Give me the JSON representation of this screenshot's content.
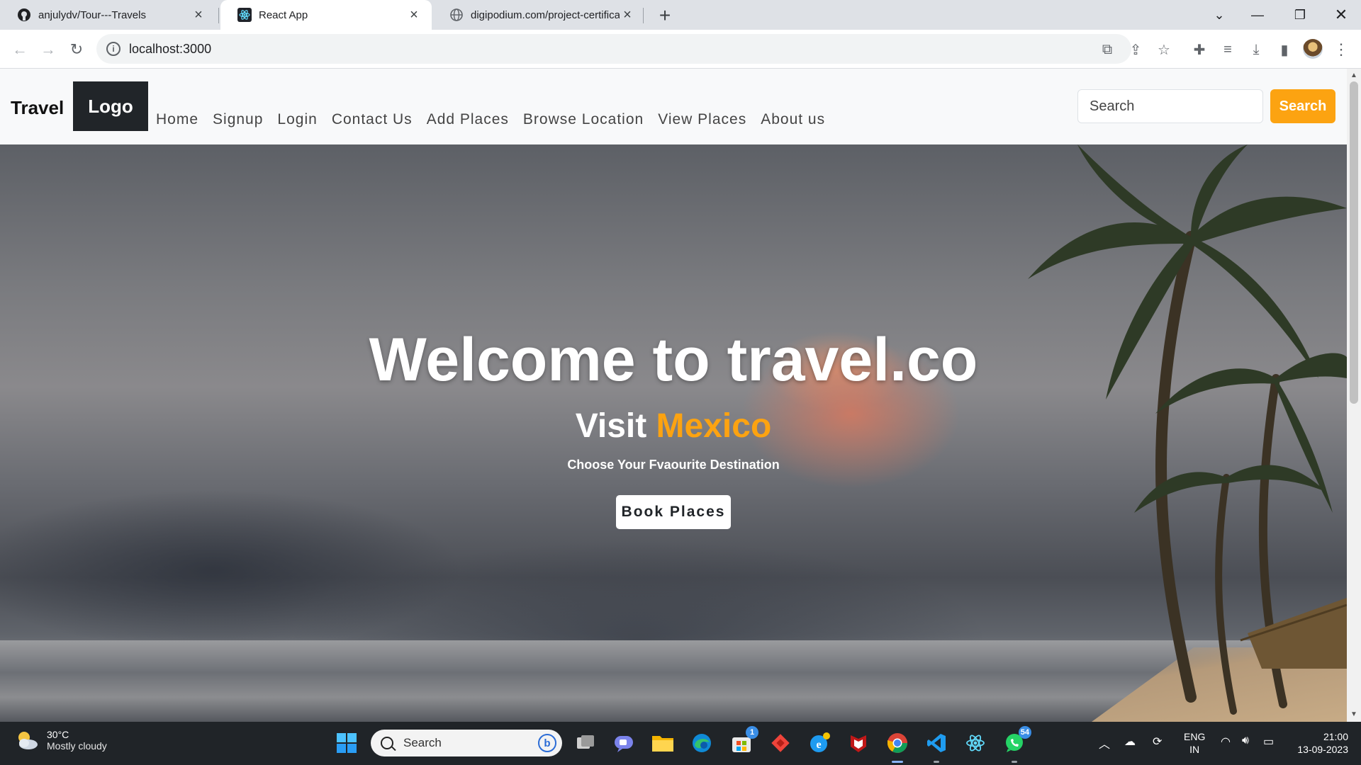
{
  "browser": {
    "tabs": [
      {
        "title": "anjulydv/Tour---Travels",
        "icon": "github-icon",
        "active": false
      },
      {
        "title": "React App",
        "icon": "react-icon",
        "active": true
      },
      {
        "title": "digipodium.com/project-certifica",
        "icon": "globe-icon",
        "active": false
      }
    ],
    "url": "localhost:3000"
  },
  "site": {
    "brand": "Travel",
    "logo": "Logo",
    "nav": [
      "Home",
      "Signup",
      "Login",
      "Contact Us",
      "Add Places",
      "Browse Location",
      "View Places",
      "About us"
    ],
    "search": {
      "placeholder": "Search",
      "button": "Search"
    },
    "hero": {
      "title": "Welcome to travel.co",
      "subtitle_prefix": "Visit",
      "subtitle_accent": "Mexico",
      "tagline": "Choose Your Fvaourite Destination",
      "cta": "Book Places"
    },
    "colors": {
      "accent": "#fca311",
      "logo_bg": "#212529",
      "nav_bg": "#f8f9fa"
    }
  },
  "taskbar": {
    "weather": {
      "temp": "30°C",
      "condition": "Mostly cloudy"
    },
    "search_placeholder": "Search",
    "store_badge": "1",
    "whatsapp_badge": "54",
    "language": {
      "line1": "ENG",
      "line2": "IN"
    },
    "time": "21:00",
    "date": "13-09-2023"
  }
}
